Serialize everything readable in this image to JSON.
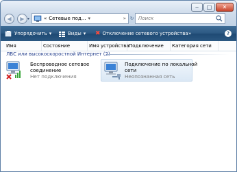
{
  "window": {
    "controls": [
      "minimize",
      "maximize",
      "close"
    ]
  },
  "navigation": {
    "back_icon": "back-arrow-icon",
    "forward_icon": "forward-arrow-icon",
    "address_prefix": "«",
    "address_text": "Сетевые под...",
    "address_dropdown": "▾",
    "separator": "»",
    "search_placeholder": "Поиск"
  },
  "toolbar": {
    "organize_label": "Упорядочить",
    "views_label": "Виды",
    "disable_label": "Отключение сетевого устройства",
    "more_label": "»",
    "help_label": "?"
  },
  "columns": [
    "Имя",
    "Состояние",
    "Имя устройства",
    "Подключение",
    "Категория сети"
  ],
  "group_title": "ЛВС или высокоскоростной Интернет (2)",
  "items": [
    {
      "name_line1": "Беспроводное сетевое",
      "name_line2": "соединение",
      "status": "Нет подключения",
      "selected": false
    },
    {
      "name_line1": "Подключение по локальной",
      "name_line2": "сети",
      "status": "Неопознанная сеть",
      "selected": true
    }
  ],
  "colors": {
    "toolbar": "#2d5a84",
    "group_text": "#1e3a8a",
    "selected_bg": "#dbe8f5",
    "error_red": "#d21d1d"
  }
}
